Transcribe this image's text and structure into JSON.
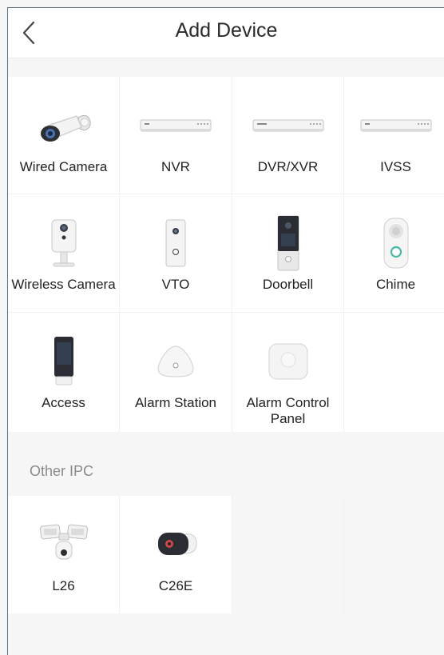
{
  "header": {
    "title": "Add Device",
    "back_icon": "chevron-left-icon"
  },
  "devices": [
    {
      "label": "Wired Camera",
      "icon": "bullet-camera-icon"
    },
    {
      "label": "NVR",
      "icon": "nvr-recorder-icon"
    },
    {
      "label": "DVR/XVR",
      "icon": "dvr-recorder-icon"
    },
    {
      "label": "IVSS",
      "icon": "ivss-recorder-icon"
    },
    {
      "label": "Wireless Camera",
      "icon": "cube-camera-icon"
    },
    {
      "label": "VTO",
      "icon": "vto-intercom-icon"
    },
    {
      "label": "Doorbell",
      "icon": "doorbell-icon"
    },
    {
      "label": "Chime",
      "icon": "chime-icon"
    },
    {
      "label": "Access",
      "icon": "access-terminal-icon"
    },
    {
      "label": "Alarm Station",
      "icon": "alarm-station-icon"
    },
    {
      "label": "Alarm Control Panel",
      "icon": "alarm-panel-icon"
    }
  ],
  "other_section": {
    "title": "Other IPC",
    "devices": [
      {
        "label": "L26",
        "icon": "floodlight-camera-icon"
      },
      {
        "label": "C26E",
        "icon": "bullet-camera-black-icon"
      }
    ]
  }
}
